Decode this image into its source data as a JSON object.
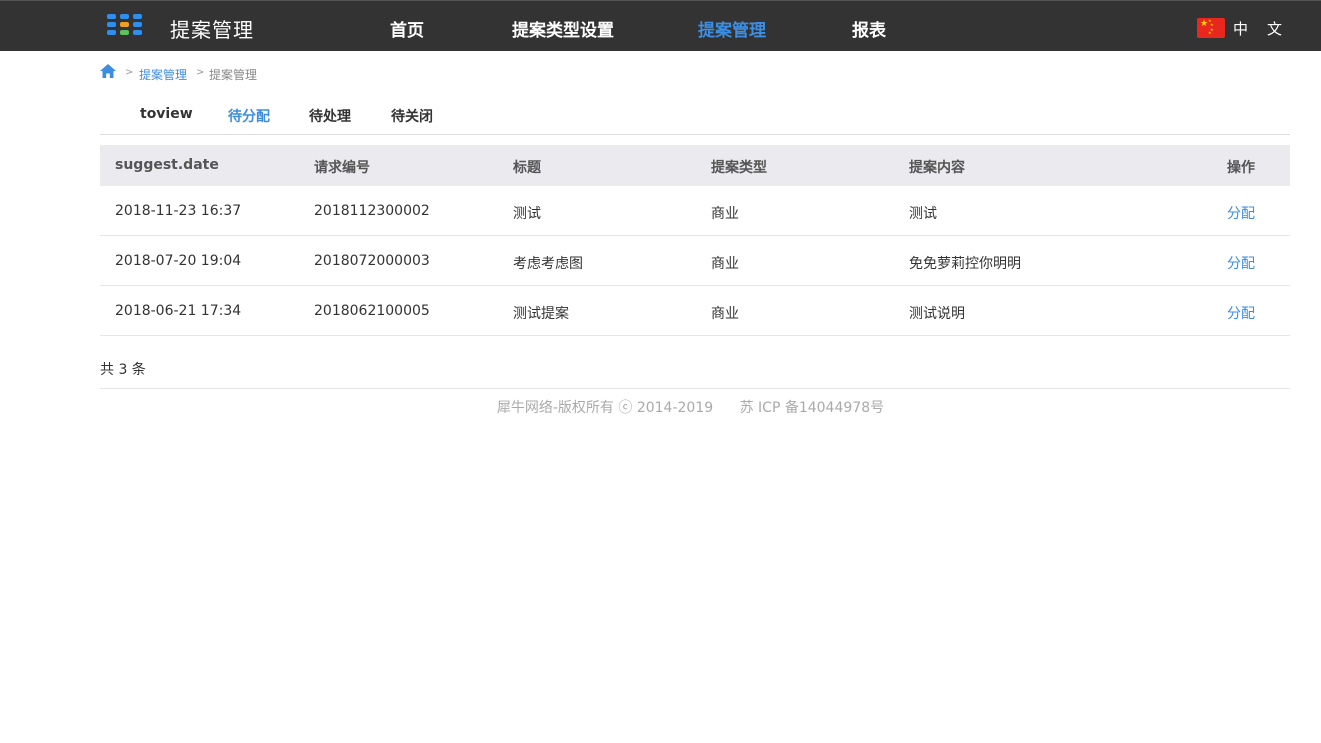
{
  "header": {
    "app_title": "提案管理",
    "logo_icon": "grid-logo-icon",
    "nav": [
      {
        "label": "首页",
        "active": false
      },
      {
        "label": "提案类型设置",
        "active": false
      },
      {
        "label": "提案管理",
        "active": true
      },
      {
        "label": "报表",
        "active": false
      }
    ],
    "language_flag": "china-flag-icon",
    "language_label": "中文"
  },
  "breadcrumb": {
    "home_icon": "home-icon",
    "separator": ">",
    "items": [
      "提案管理",
      "提案管理"
    ]
  },
  "tabs": [
    {
      "label": "toview",
      "active": false
    },
    {
      "label": "待分配",
      "active": true
    },
    {
      "label": "待处理",
      "active": false
    },
    {
      "label": "待关闭",
      "active": false
    }
  ],
  "table": {
    "columns": [
      "suggest.date",
      "请求编号",
      "标题",
      "提案类型",
      "提案内容",
      "操作"
    ],
    "rows": [
      {
        "date": "2018-11-23 16:37",
        "number": "2018112300002",
        "title": "测试",
        "type": "商业",
        "content": "测试",
        "action": "分配"
      },
      {
        "date": "2018-07-20 19:04",
        "number": "2018072000003",
        "title": "考虑考虑图",
        "type": "商业",
        "content": "免免萝莉控你明明",
        "action": "分配"
      },
      {
        "date": "2018-06-21 17:34",
        "number": "2018062100005",
        "title": "测试提案",
        "type": "商业",
        "content": "测试说明",
        "action": "分配"
      }
    ]
  },
  "total_text": "共 3 条",
  "footer": {
    "copyright": "犀牛网络-版权所有 ⓒ 2014-2019",
    "icp": "苏 ICP 备14044978号"
  },
  "colors": {
    "topbar": "#333333",
    "accent": "#3d8de0",
    "table_header": "#ebeaef"
  }
}
